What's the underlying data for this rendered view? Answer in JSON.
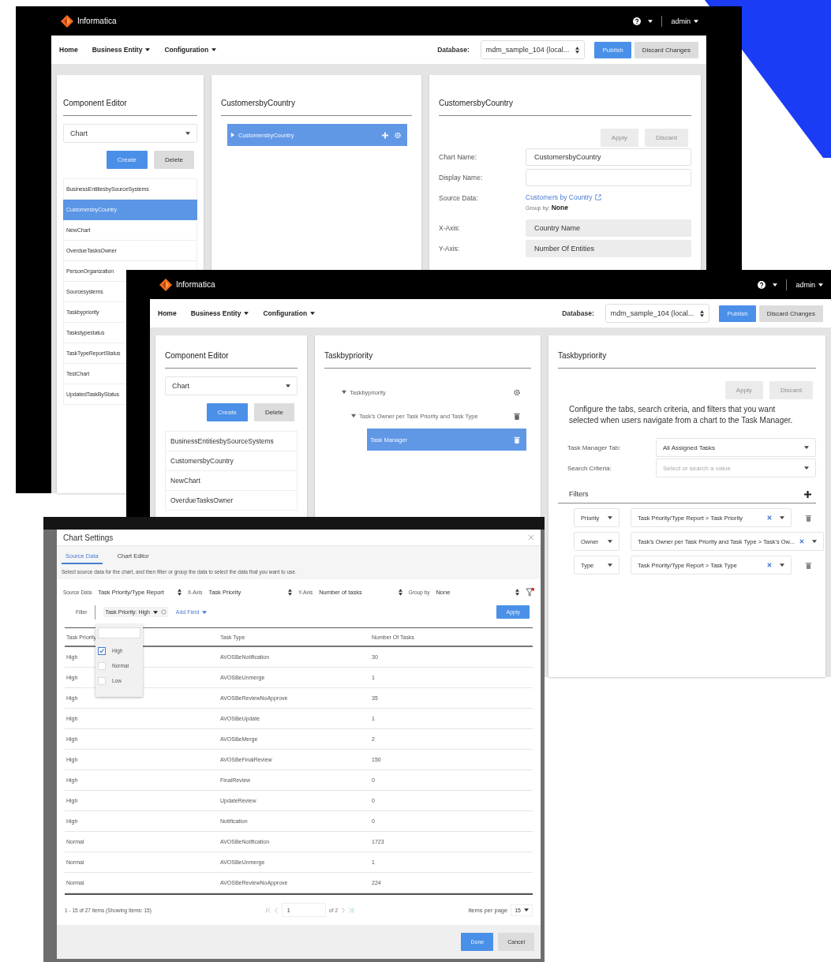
{
  "background_windows": [
    {
      "app_name": "Informatica",
      "user": "admin",
      "nav": [
        {
          "label": "Home",
          "menu": false
        },
        {
          "label": "Business Entity",
          "menu": true
        },
        {
          "label": "Configuration",
          "menu": true
        }
      ],
      "database_label": "Database:",
      "database": "mdm_sample_104 (local...",
      "nav_buttons": [
        {
          "label": "Publish",
          "primary": true
        },
        {
          "label": "Discard Changes",
          "primary": false
        }
      ],
      "component_editor": {
        "title": "Component Editor",
        "type": "Chart",
        "buttons": [
          {
            "label": "Create",
            "primary": true
          },
          {
            "label": "Delete",
            "primary": false
          }
        ],
        "items": [
          {
            "label": "BusinessEntitiesbySourceSystems",
            "selected": false
          },
          {
            "label": "CustomersbyCountry",
            "selected": true
          },
          {
            "label": "NewChart",
            "selected": false
          },
          {
            "label": "OverdueTasksOwner",
            "selected": false
          },
          {
            "label": "PersonOrganization",
            "selected": false
          },
          {
            "label": "Sourcesystems",
            "selected": false
          },
          {
            "label": "Taskbypriority",
            "selected": false
          },
          {
            "label": "Taskstypestatus",
            "selected": false
          },
          {
            "label": "TaskTypeReportStatus",
            "selected": false
          },
          {
            "label": "TestChart",
            "selected": false
          },
          {
            "label": "UpdatedTaskByStatus",
            "selected": false
          }
        ]
      },
      "tree": {
        "title": "CustomersbyCountry",
        "nodes": [
          {
            "label": "CustomersbyCountry",
            "expanded": false,
            "selected": true,
            "addable": true
          }
        ]
      },
      "details": {
        "kind": "chart_form",
        "title": "CustomersbyCountry",
        "actions": [
          {
            "label": "Apply",
            "disabled": true
          },
          {
            "label": "Discard",
            "disabled": true
          }
        ],
        "fields": [
          {
            "label": "Chart Name:",
            "kind": "input",
            "value": "CustomersbyCountry"
          },
          {
            "label": "Display Name:",
            "kind": "input"
          },
          {
            "label": "Source Data:",
            "kind": "link",
            "value": "Customers by Country",
            "group_label": "Group by:",
            "group_value": "None"
          },
          {
            "label": "X-Axis:",
            "kind": "readonly",
            "value": "Country Name"
          },
          {
            "label": "Y-Axis:",
            "kind": "readonly",
            "value": "Number Of Entities"
          }
        ]
      }
    },
    {
      "app_name": "Informatica",
      "user": "admin",
      "nav": [
        {
          "label": "Home",
          "menu": false
        },
        {
          "label": "Business Entity",
          "menu": true
        },
        {
          "label": "Configuration",
          "menu": true
        }
      ],
      "database_label": "Database:",
      "database": "mdm_sample_104 (local...",
      "nav_buttons": [
        {
          "label": "Publish",
          "primary": true
        },
        {
          "label": "Discard Changes",
          "primary": false
        }
      ],
      "component_editor": {
        "title": "Component Editor",
        "type": "Chart",
        "buttons": [
          {
            "label": "Create",
            "primary": true
          },
          {
            "label": "Delete",
            "primary": false
          }
        ],
        "items": [
          {
            "label": "BusinessEntitiesbySourceSystems",
            "selected": false
          },
          {
            "label": "CustomersbyCountry",
            "selected": false
          },
          {
            "label": "NewChart",
            "selected": false
          },
          {
            "label": "OverdueTasksOwner",
            "selected": false
          }
        ]
      },
      "tree": {
        "title": "Taskbypriority",
        "nodes": [
          {
            "label": "Taskbypriority",
            "expanded": true,
            "selected": false,
            "addable": false,
            "children": [
              {
                "label": "Task's Owner per Task Priority and Task Type",
                "expanded": true,
                "selected": false,
                "addable": false,
                "children": [
                  {
                    "label": "Task Manager",
                    "selected": true,
                    "addable": false
                  }
                ]
              }
            ]
          }
        ]
      },
      "details": {
        "kind": "task_manager",
        "title": "Taskbypriority",
        "actions": [
          {
            "label": "Apply",
            "disabled": true
          },
          {
            "label": "Discard",
            "disabled": true
          }
        ],
        "description": "Configure the tabs, search criteria, and filters that you want selected when users navigate from a chart to the Task Manager.",
        "selects": [
          {
            "label": "Task Manager Tab:",
            "value": "All Assigned Tasks"
          },
          {
            "label": "Search Criteria:",
            "placeholder": "Select or search a value"
          }
        ],
        "filters_title": "Filters",
        "filters": [
          {
            "field": "Priority",
            "value": "Task Priority/Type Report > Task Priority"
          },
          {
            "field": "Owner",
            "value": "Task's Owner per Task Priority and Task Type > Task's Ow..."
          },
          {
            "field": "Type",
            "value": "Task Priority/Type Report > Task Type"
          }
        ]
      }
    }
  ],
  "modal": {
    "title": "Chart Settings",
    "tabs": [
      {
        "label": "Source Data",
        "selected": true
      },
      {
        "label": "Chart Editor",
        "selected": false
      }
    ],
    "description": "Select source data for the chart, and then filter or group the data to select the data that you want to use.",
    "selects": [
      {
        "label": "Source Data",
        "value": "Task Priority/Type Report"
      },
      {
        "label": "X-Axis",
        "value": "Task Priority"
      },
      {
        "label": "Y-Axis",
        "value": "Number of tasks"
      },
      {
        "label": "Group by",
        "value": "None"
      }
    ],
    "filter_label": "Filter",
    "filter_chip": "Task Priority: High",
    "add_field": "Add Field",
    "apply": "Apply",
    "filter_options": [
      {
        "label": "High",
        "checked": true
      },
      {
        "label": "Normal",
        "checked": false
      },
      {
        "label": "Low",
        "checked": false
      }
    ],
    "columns": [
      "Task Priority",
      "Task Type",
      "Number Of Tasks"
    ],
    "rows": [
      [
        "High",
        "AVOSBeNotification",
        "30"
      ],
      [
        "High",
        "AVOSBeUnmerge",
        "1"
      ],
      [
        "High",
        "AVOSBeReviewNoApprove",
        "35"
      ],
      [
        "High",
        "AVOSBeUpdate",
        "1"
      ],
      [
        "High",
        "AVOSBeMerge",
        "2"
      ],
      [
        "High",
        "AVOSBeFinalReview",
        "150"
      ],
      [
        "High",
        "FinalReview",
        "0"
      ],
      [
        "High",
        "UpdateReview",
        "0"
      ],
      [
        "High",
        "Notification",
        "0"
      ],
      [
        "Normal",
        "AVOSBeNotification",
        "1723"
      ],
      [
        "Normal",
        "AVOSBeUnmerge",
        "1"
      ],
      [
        "Normal",
        "AVOSBeReviewNoApprove",
        "224"
      ]
    ],
    "summary": "1 - 15 of 27 items (Showing Items: 15)",
    "page": "1",
    "page_total": "of 2",
    "per_page_label": "Items per page",
    "per_page": "15",
    "buttons": [
      {
        "label": "Done",
        "primary": true
      },
      {
        "label": "Cancel",
        "primary": false
      }
    ]
  }
}
